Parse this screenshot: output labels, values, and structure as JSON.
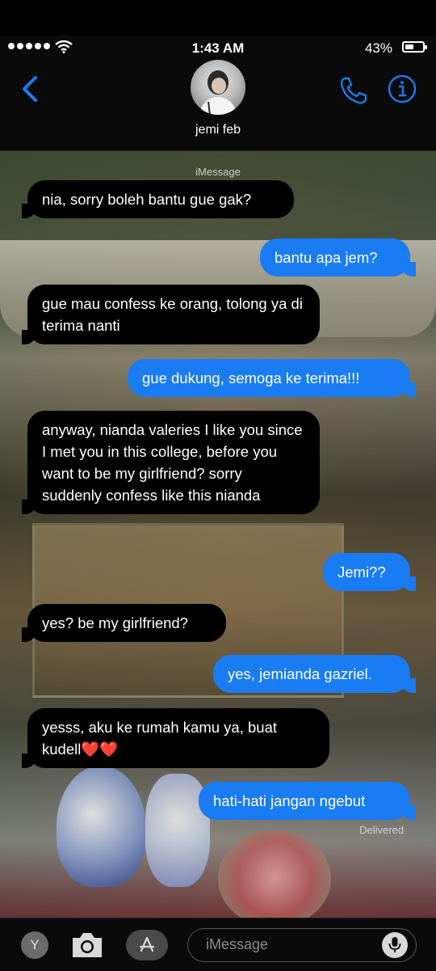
{
  "status_bar": {
    "time": "1:43 AM",
    "battery_percent": "43%",
    "battery_level": 0.43,
    "signal_bars": 5
  },
  "header": {
    "contact_name": "jemi feb"
  },
  "chat": {
    "service_label": "iMessage",
    "delivered_label": "Delivered",
    "messages": [
      {
        "direction": "incoming",
        "text": "nia, sorry boleh bantu gue gak?"
      },
      {
        "direction": "outgoing",
        "text": "bantu apa jem?"
      },
      {
        "direction": "incoming",
        "text": "gue mau confess ke orang, tolong ya di terima nanti"
      },
      {
        "direction": "outgoing",
        "text": "gue dukung, semoga ke terima!!!"
      },
      {
        "direction": "incoming",
        "text": "anyway, nianda valeries I like you since I met you in this college, before you want to be my girlfriend? sorry suddenly confess like this nianda"
      },
      {
        "direction": "outgoing",
        "text": "Jemi??"
      },
      {
        "direction": "incoming",
        "text": "yes? be my girlfriend?"
      },
      {
        "direction": "outgoing",
        "text": "yes, jemianda gazriel."
      },
      {
        "direction": "incoming",
        "text": "yesss, aku ke rumah kamu ya, buat kudell❤️❤️"
      },
      {
        "direction": "outgoing",
        "text": "hati-hati jangan ngebut"
      }
    ]
  },
  "input_bar": {
    "placeholder": "iMessage",
    "app_button_label": "Y"
  },
  "colors": {
    "outgoing_bubble": "#1a7cf2",
    "incoming_bubble": "#000000",
    "accent": "#1a7cf2"
  }
}
